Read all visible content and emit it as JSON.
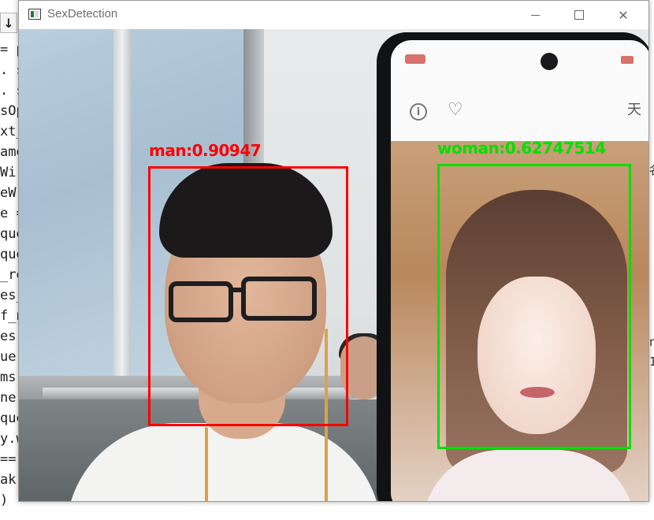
{
  "window": {
    "title": "SexDetection",
    "icon": "app-window-icon",
    "controls": [
      "minimize",
      "maximize",
      "close"
    ]
  },
  "background_editor": {
    "toolbar_glyph": "↓",
    "left_fragments": [
      "= p",
      ". s",
      ". s",
      "sOp",
      "xt_",
      "ame",
      "Wi",
      "eW",
      "e =",
      "que",
      "que",
      "_re",
      "es_",
      "f_n",
      "es,",
      "ue",
      "ms",
      "ne",
      "que",
      "y.w",
      "==",
      "ak",
      ")"
    ],
    "right_fragments": [
      "名",
      "n",
      "1"
    ]
  },
  "detections": [
    {
      "label": "man:0.90947",
      "color": "#ff0000"
    },
    {
      "label": "woman:0.62747514",
      "color": "#00e000"
    }
  ],
  "phone": {
    "header_char": "天",
    "info_icon": "info-icon",
    "heart_icon": "heart-icon"
  }
}
